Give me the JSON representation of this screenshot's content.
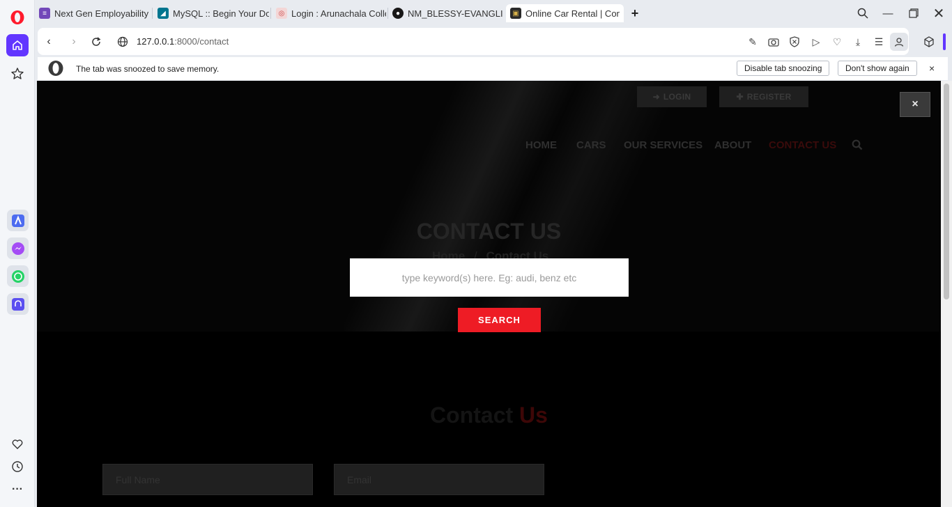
{
  "browser": {
    "tabs": [
      {
        "title": "Next Gen Employability Pr",
        "icon": "forms-icon",
        "color": "#7248b9"
      },
      {
        "title": "MySQL :: Begin Your Down",
        "icon": "mysql-icon",
        "color": "#00758f"
      },
      {
        "title": "Login : Arunachala College",
        "icon": "college-icon",
        "color": "#e07a7a"
      },
      {
        "title": "NM_BLESSY-EVANGLINE_",
        "icon": "github-icon",
        "color": "#181717"
      },
      {
        "title": "Online Car Rental | Contac",
        "icon": "car-rental-icon",
        "color": "#8a6d1e"
      }
    ],
    "url": {
      "host": "127.0.0.1",
      "path": ":8000/contact"
    },
    "infobar": {
      "message": "The tab was snoozed to save memory.",
      "disable_label": "Disable tab snoozing",
      "dismiss_label": "Don't show again",
      "close_glyph": "×"
    },
    "accent_color": "#6236ff"
  },
  "site": {
    "top_buttons": {
      "login": "LOGIN",
      "register": "REGISTER"
    },
    "nav": [
      "HOME",
      "CARS",
      "OUR SERVICES",
      "ABOUT",
      "CONTACT US"
    ],
    "hero_title": "CONTACT US",
    "breadcrumb": {
      "home": "Home",
      "separator": "/",
      "current": "Contact Us"
    },
    "section_heading": {
      "first": "Contact",
      "second": "Us"
    },
    "form": {
      "name_placeholder": "Full Name",
      "email_placeholder": "Email"
    }
  },
  "search_overlay": {
    "placeholder": "type keyword(s) here. Eg: audi, benz etc",
    "button_label": "SEARCH",
    "close_glyph": "×",
    "button_color": "#ee1c25"
  }
}
